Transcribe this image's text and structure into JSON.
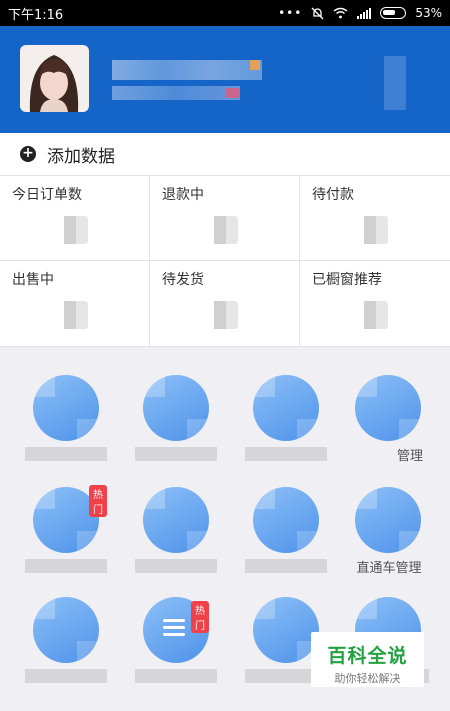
{
  "status_bar": {
    "time": "下午1:16",
    "battery": "53%"
  },
  "profile": {
    "name": "",
    "subtitle": ""
  },
  "add_data": {
    "label": "添加数据"
  },
  "stats": [
    {
      "label": "今日订单数"
    },
    {
      "label": "退款中"
    },
    {
      "label": "待付款"
    },
    {
      "label": "出售中"
    },
    {
      "label": "待发货"
    },
    {
      "label": "已橱窗推荐"
    }
  ],
  "tools": [
    {
      "label": ""
    },
    {
      "label": ""
    },
    {
      "label": ""
    },
    {
      "label": "管理"
    },
    {
      "label": "",
      "badge": "热门"
    },
    {
      "label": ""
    },
    {
      "label": ""
    },
    {
      "label": "直通车管理"
    },
    {
      "label": ""
    },
    {
      "label": "",
      "badge": "热门"
    },
    {
      "label": ""
    },
    {
      "label": ""
    }
  ],
  "watermark": {
    "title": "百科全说",
    "subtitle": "助你轻松解决"
  },
  "colors": {
    "header": "#1565c8",
    "accent_icon": "#5c9cef",
    "hot_badge": "#f0414a",
    "watermark_green": "#23a140"
  }
}
